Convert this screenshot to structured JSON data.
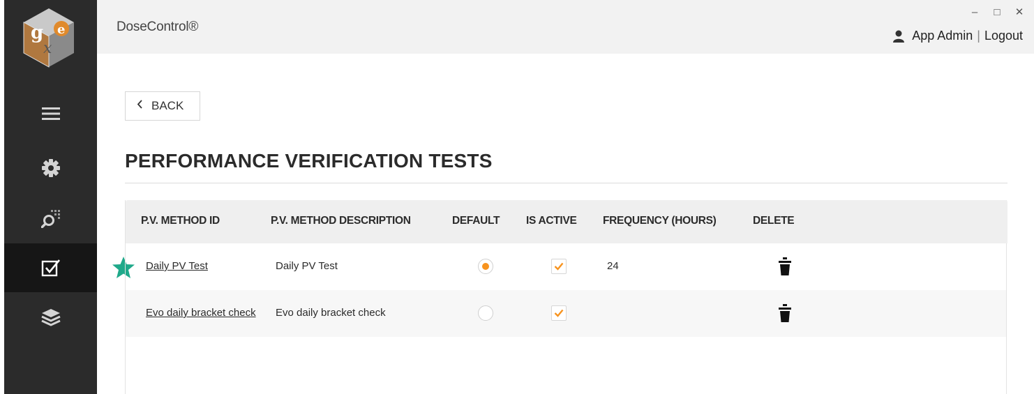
{
  "app": {
    "title": "DoseControl®"
  },
  "window": {
    "minimize": "–",
    "maximize": "□",
    "close": "✕"
  },
  "user": {
    "name": "App Admin",
    "separator": "|",
    "logout": "Logout"
  },
  "sidebar": {
    "items": [
      {
        "name": "menu",
        "icon": "hamburger-icon",
        "active": false
      },
      {
        "name": "settings",
        "icon": "gear-icon",
        "active": false
      },
      {
        "name": "search",
        "icon": "search-grid-icon",
        "active": false
      },
      {
        "name": "verification",
        "icon": "checkbox-icon",
        "active": true
      },
      {
        "name": "layers",
        "icon": "layers-icon",
        "active": false
      }
    ]
  },
  "back": {
    "label": "BACK"
  },
  "page": {
    "title": "PERFORMANCE VERIFICATION TESTS"
  },
  "table": {
    "headers": [
      "P.V. METHOD ID",
      "P.V. METHOD DESCRIPTION",
      "DEFAULT",
      "IS ACTIVE",
      "FREQUENCY (HOURS)",
      "DELETE"
    ],
    "rows": [
      {
        "id": "Daily PV Test",
        "description": "Daily PV Test",
        "default": true,
        "active": true,
        "frequency": "24",
        "starred": true
      },
      {
        "id": "Evo daily bracket check",
        "description": "Evo daily bracket check",
        "default": false,
        "active": true,
        "frequency": "",
        "starred": false
      }
    ]
  },
  "colors": {
    "sidebar": "#2b2b2b",
    "accent": "#f7931e",
    "star": "#1fa98a"
  }
}
